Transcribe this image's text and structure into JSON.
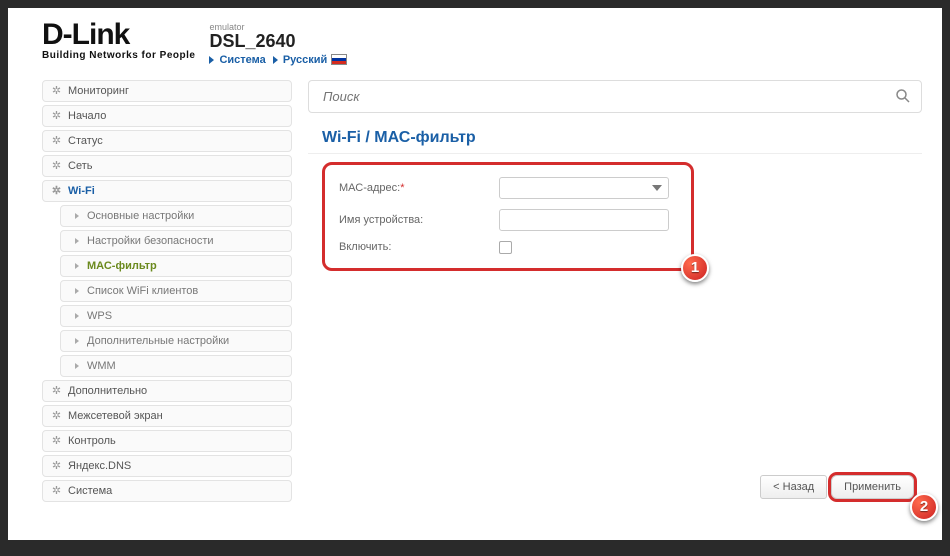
{
  "header": {
    "logo": "D-Link",
    "logo_tag": "Building Networks for People",
    "emulator": "emulator",
    "model": "DSL_2640",
    "crumbs": [
      "Система",
      "Русский"
    ]
  },
  "search": {
    "placeholder": "Поиск"
  },
  "sidebar": {
    "items": [
      {
        "label": "Мониторинг"
      },
      {
        "label": "Начало"
      },
      {
        "label": "Статус"
      },
      {
        "label": "Сеть"
      },
      {
        "label": "Wi-Fi",
        "active": true
      },
      {
        "label": "Дополнительно"
      },
      {
        "label": "Межсетевой экран"
      },
      {
        "label": "Контроль"
      },
      {
        "label": "Яндекс.DNS"
      },
      {
        "label": "Система"
      }
    ],
    "wifi_sub": [
      {
        "label": "Основные настройки"
      },
      {
        "label": "Настройки безопасности"
      },
      {
        "label": "МАС-фильтр",
        "active": true
      },
      {
        "label": "Список WiFi клиентов"
      },
      {
        "label": "WPS"
      },
      {
        "label": "Дополнительные настройки"
      },
      {
        "label": "WMM"
      }
    ]
  },
  "main": {
    "title": "Wi-Fi  /  МАС-фильтр",
    "form": {
      "mac_label": "МАС-адрес:",
      "mac_value": "",
      "devname_label": "Имя устройства:",
      "devname_value": "",
      "enable_label": "Включить:",
      "enable_checked": false
    },
    "buttons": {
      "back": "< Назад",
      "apply": "Применить"
    }
  },
  "annotations": {
    "badge1": "1",
    "badge2": "2"
  }
}
